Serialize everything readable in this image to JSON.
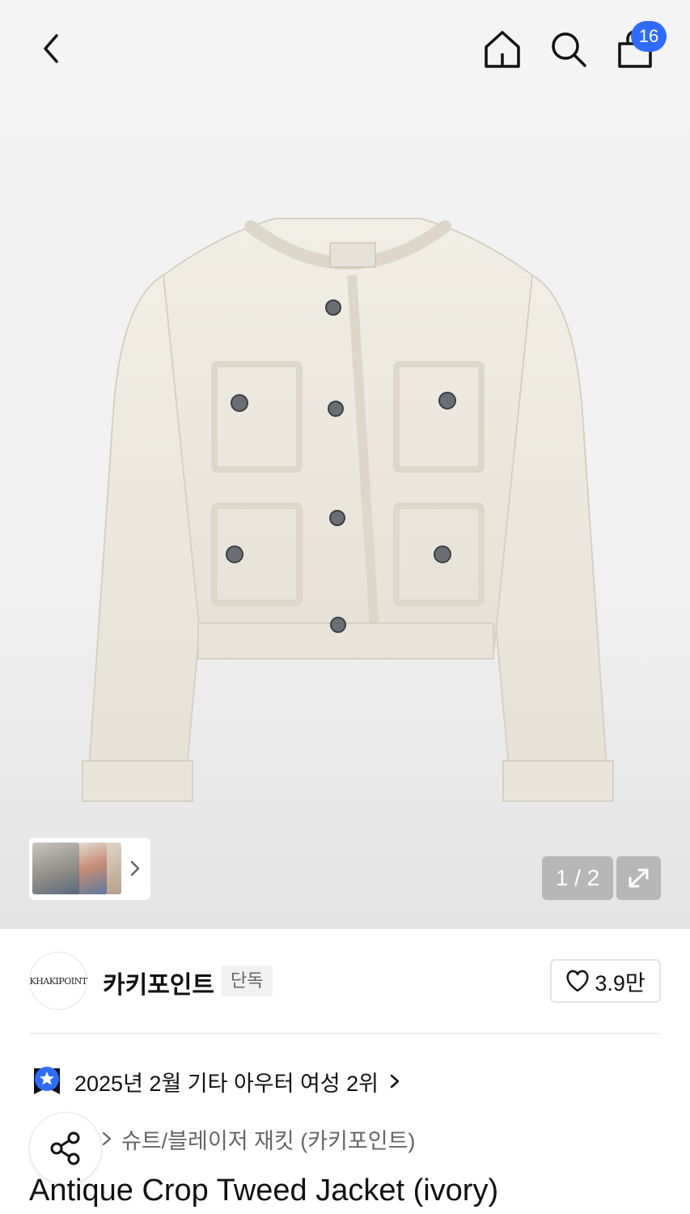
{
  "header": {
    "back_icon": "chevron-left-icon",
    "home_icon": "home-icon",
    "search_icon": "search-icon",
    "cart_icon": "shopping-bag-icon",
    "cart_badge": "16",
    "badge_color": "#2f6bff"
  },
  "gallery": {
    "counter": "1 / 2",
    "expand_icon": "expand-icon",
    "thumbs_chevron_icon": "chevron-right-icon"
  },
  "brand": {
    "logo_text": "KHAKIPOINT",
    "name": "카키포인트",
    "exclusive_tag": "단독",
    "like_icon": "heart-icon",
    "like_count": "3.9만"
  },
  "ranking": {
    "icon": "badge-star-icon",
    "text": "2025년 2월 기타 아우터 여성 2위",
    "accent_color": "#2f6bff"
  },
  "category": {
    "text": "슈트/블레이저 재킷 (카키포인트)"
  },
  "share": {
    "icon": "share-icon"
  },
  "product": {
    "title": "Antique Crop Tweed Jacket (ivory)"
  }
}
